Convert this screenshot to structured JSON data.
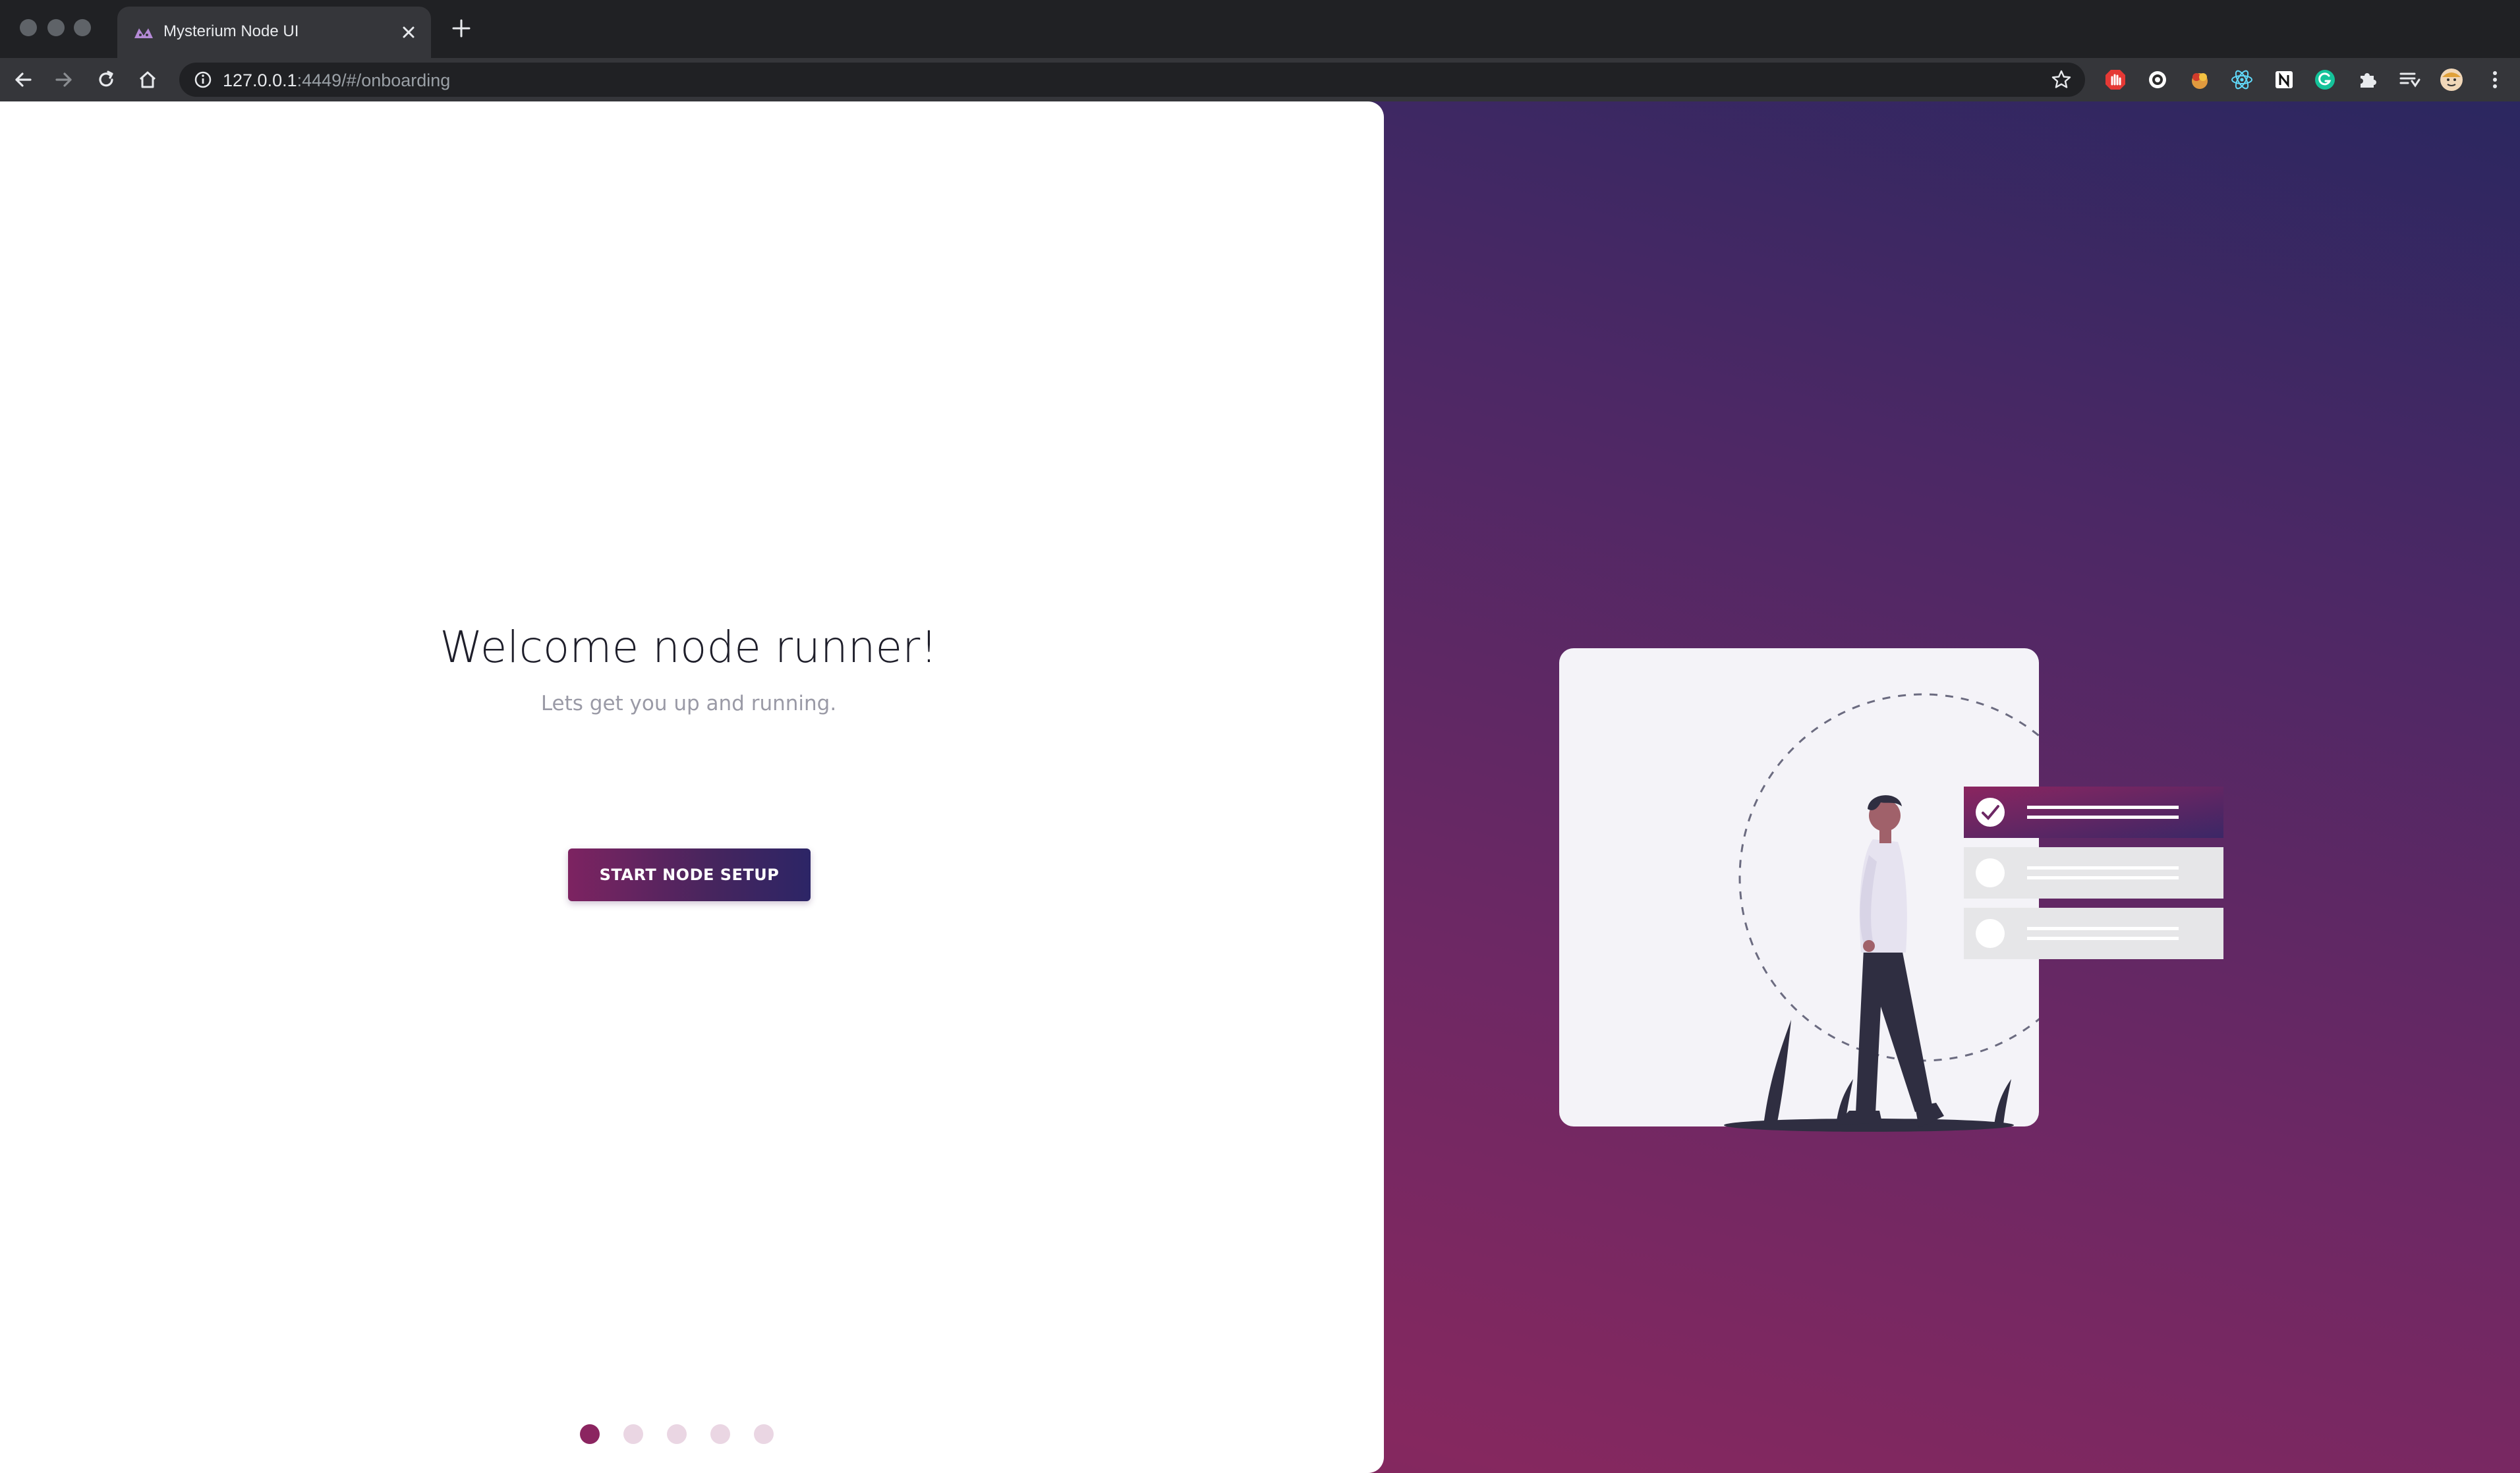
{
  "browser": {
    "tab": {
      "title": "Mysterium Node UI",
      "favicon": "mysterium-logo-icon"
    },
    "url": {
      "host": "127.0.0.1",
      "rest": ":4449/#/onboarding"
    },
    "extensions": [
      "adblock-icon",
      "circle-extension-icon",
      "turkey-extension-icon",
      "react-devtools-icon",
      "notion-icon",
      "grammarly-icon",
      "puzzle-icon",
      "reading-list-icon",
      "profile-avatar",
      "more-menu-icon"
    ]
  },
  "onboarding": {
    "title": "Welcome node runner!",
    "subtitle": "Lets get you up and running.",
    "start_button": "START NODE SETUP",
    "steps": {
      "total": 5,
      "current": 1
    }
  },
  "colors": {
    "brand_magenta": "#8b2560",
    "brand_indigo": "#2c2566",
    "dot_inactive": "#ead6e3"
  }
}
